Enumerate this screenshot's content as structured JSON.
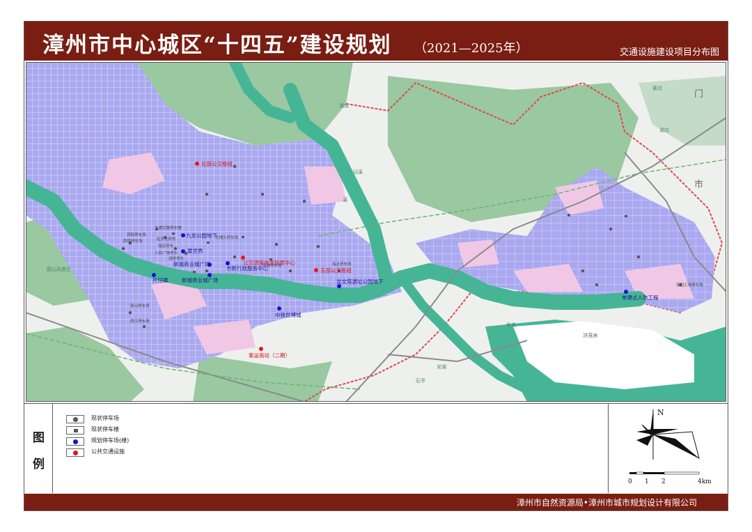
{
  "header": {
    "title": "漳州市中心城区“十四五”建设规划",
    "years": "（2021—2025年）",
    "subtitle": "交通设施建设项目分布图"
  },
  "map": {
    "blue_points": [
      {
        "label": "九龙公园地下"
      },
      {
        "label": "豪世界"
      },
      {
        "label": "新城商业城广场"
      },
      {
        "label": "市新行政服务中心"
      },
      {
        "label": "片仔癀"
      },
      {
        "label": "新城商业城广场"
      },
      {
        "label": "中铁世博城"
      },
      {
        "label": "龙文塔遗址公园地下"
      },
      {
        "label": "单建式人防工程"
      }
    ],
    "red_points": [
      {
        "label": "北部公交枢纽"
      },
      {
        "label": "公交调度信息指挥中心"
      },
      {
        "label": "东部公交枢纽"
      },
      {
        "label": "客运南站（二期）"
      }
    ],
    "small_labels": [
      "西院停车场",
      "西院停车场",
      "大通北路停车楼",
      "延安北停车",
      "瑞京停车",
      "人民广场停车",
      "双桥停车",
      "东铺头停车场",
      "南湖停车场",
      "南山停车场",
      "海沧停车场",
      "西江停车场",
      "花园工场停车场"
    ],
    "place_labels": [
      "圆山风景区",
      "汕溪",
      "溪",
      "浦南",
      "黄坑",
      "湖坑",
      "市",
      "门",
      "龙湖",
      "角美",
      "浒茂洲",
      "石亭"
    ],
    "colors": {
      "water": "#46b596",
      "forest": "#9ac8a0",
      "urban_blue": "#a9a8f0",
      "urban_pink": "#f0c8e6",
      "boundary": "#e04848"
    }
  },
  "legend": {
    "title_top": "图",
    "title_bottom": "例",
    "items": [
      {
        "label": "现状停车场",
        "icon": "gray-dot-icon",
        "color": "#555555"
      },
      {
        "label": "现状停车楼",
        "icon": "gray-square-icon",
        "color": "#555555"
      },
      {
        "label": "规划停车场(楼)",
        "icon": "blue-dot-icon",
        "color": "#1414d0"
      },
      {
        "label": "公共交通设施",
        "icon": "red-dot-icon",
        "color": "#e01818"
      }
    ]
  },
  "compass": {
    "north": "N"
  },
  "scale": {
    "ticks": [
      "0",
      "1",
      "2",
      "4km"
    ]
  },
  "footer": {
    "credit": "漳州市自然资源局•漳州市城市规划设计有限公司"
  }
}
